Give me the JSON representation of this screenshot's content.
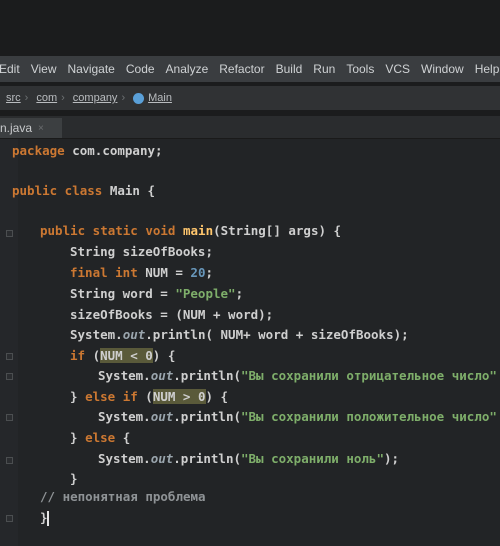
{
  "menu": [
    "Edit",
    "View",
    "Navigate",
    "Code",
    "Analyze",
    "Refactor",
    "Build",
    "Run",
    "Tools",
    "VCS",
    "Window",
    "Help"
  ],
  "breadcrumb": {
    "items": [
      "src",
      "com",
      "company"
    ],
    "current": "Main",
    "icon": "class-icon"
  },
  "tab": {
    "label": "n.java",
    "close": "×"
  },
  "code": {
    "l1_kw": "package ",
    "l1_rest": "com.company;",
    "l2_kw": "public class ",
    "l2_rest": "Main {",
    "l3_kw": "public static void ",
    "l3_fn": "main",
    "l3_rest": "(String[] args) {",
    "l4": "String sizeOfBooks;",
    "l5_kw": "final int ",
    "l5_mid": "NUM = ",
    "l5_num": "20",
    "l5_end": ";",
    "l6_pre": "String word = ",
    "l6_str": "\"People\"",
    "l6_end": ";",
    "l7": "sizeOfBooks = (NUM + word);",
    "l8_pre": "System.",
    "l8_out": "out",
    "l8_rest": ".println( NUM+ word + sizeOfBooks);",
    "l9_kw": "if ",
    "l9_open": "(",
    "l9_cond": "NUM < 0",
    "l9_end": ") {",
    "l10_pre": "System.",
    "l10_out": "out",
    "l10_mid": ".println(",
    "l10_str": "\"Вы сохранили отрицательное число\"",
    "l11_close": "} ",
    "l11_kw": "else if ",
    "l11_open": "(",
    "l11_cond": "NUM > 0",
    "l11_end": ") {",
    "l12_pre": "System.",
    "l12_out": "out",
    "l12_mid": ".println(",
    "l12_str": "\"Вы сохранили положительное число\"",
    "l13_close": "} ",
    "l13_kw": "else ",
    "l13_end": "{",
    "l14_pre": "System.",
    "l14_out": "out",
    "l14_mid": ".println(",
    "l14_str": "\"Вы сохранили ноль\"",
    "l14_end": ");",
    "l15": "}",
    "l16": "// непонятная проблема",
    "l17": "}"
  }
}
